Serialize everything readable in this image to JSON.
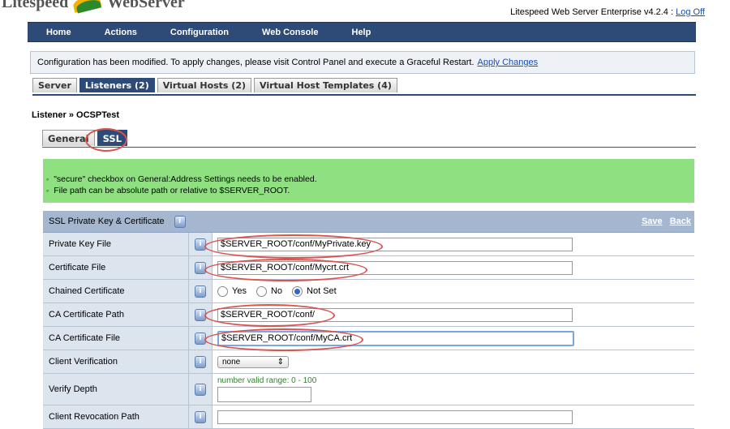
{
  "header": {
    "logo_left": "Litespeed",
    "logo_right": "WebServer",
    "version_text": "Litespeed Web Server Enterprise v4.2.4 :",
    "logoff_label": "Log Off"
  },
  "nav": [
    "Home",
    "Actions",
    "Configuration",
    "Web Console",
    "Help"
  ],
  "notice": {
    "text": "Configuration has been modified. To apply changes, please visit Control Panel and execute a Graceful Restart.",
    "link": "Apply Changes"
  },
  "tabs": [
    "Server",
    "Listeners (2)",
    "Virtual Hosts (2)",
    "Virtual Host Templates (4)"
  ],
  "breadcrumb": "Listener » OCSPTest",
  "sub_tabs": [
    "General",
    "SSL"
  ],
  "info_lines": [
    "\"secure\" checkbox on General:Address Settings needs to be enabled.",
    "File path can be absolute path or relative to $SERVER_ROOT."
  ],
  "section": {
    "title": "SSL Private Key & Certificate",
    "save": "Save",
    "back": "Back"
  },
  "fields": {
    "private_key": {
      "label": "Private Key File",
      "value": "$SERVER_ROOT/conf/MyPrivate.key"
    },
    "certificate": {
      "label": "Certificate File",
      "value": "$SERVER_ROOT/conf/Mycrt.crt"
    },
    "chained": {
      "label": "Chained Certificate",
      "opt_yes": "Yes",
      "opt_no": "No",
      "opt_notset": "Not Set"
    },
    "ca_path": {
      "label": "CA Certificate Path",
      "value": "$SERVER_ROOT/conf/"
    },
    "ca_file": {
      "label": "CA Certificate File",
      "value": "$SERVER_ROOT/conf/MyCA.crt"
    },
    "client_verification": {
      "label": "Client Verification",
      "value": "none"
    },
    "verify_depth": {
      "label": "Verify Depth",
      "hint": "number valid range: 0 - 100"
    },
    "revocation": {
      "label": "Client Revocation Path"
    }
  },
  "icons": {
    "info": "info-icon",
    "select_arrow": "updown-arrow-icon"
  },
  "colors": {
    "nav": "#2e4b78",
    "info_box": "#8fe080",
    "section_head": "#a4b7cf",
    "highlight_ring": "#d9534f"
  }
}
